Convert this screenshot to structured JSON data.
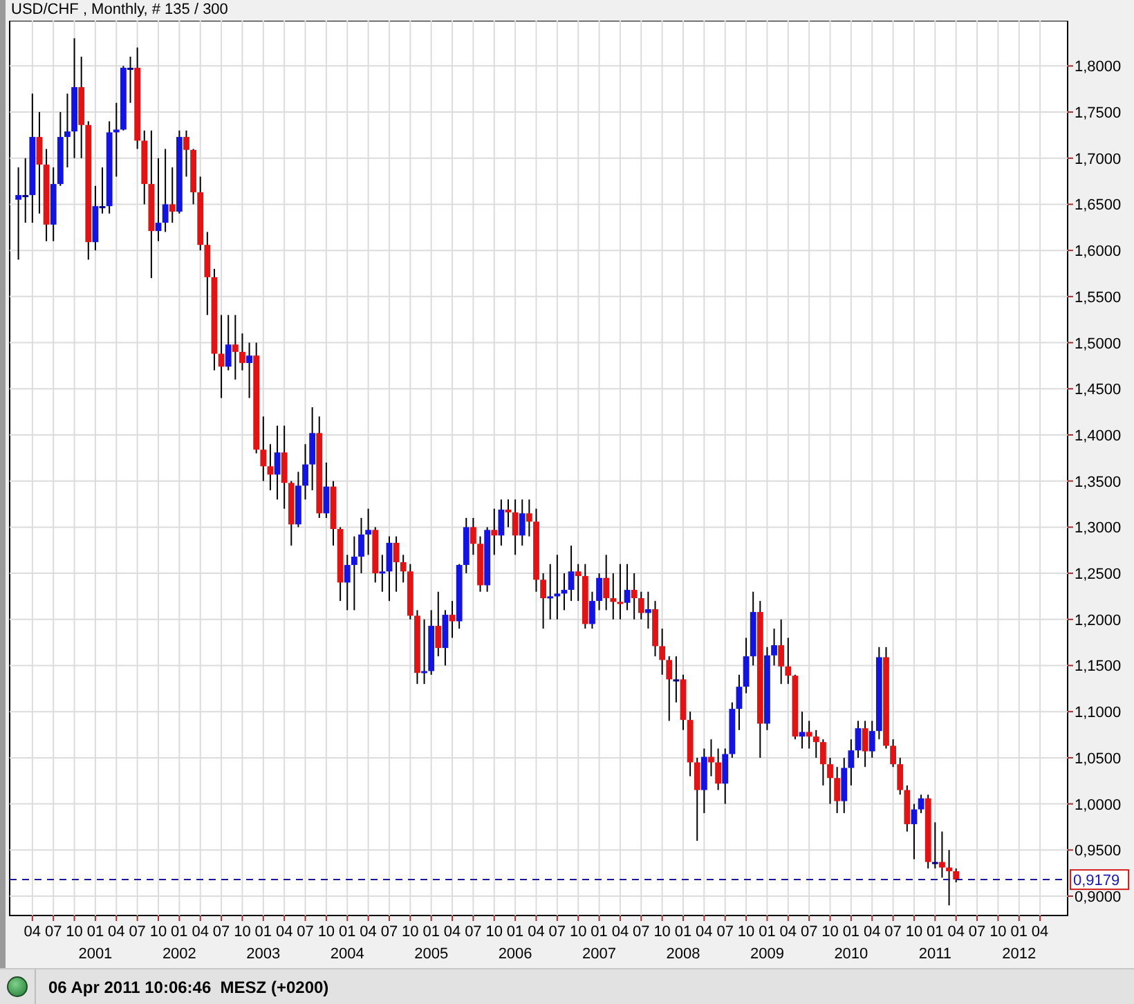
{
  "chart": {
    "chart_data": {
      "type": "candlestick",
      "title": "USD/CHF , Monthly, # 135 / 300",
      "grid": true,
      "ylim": [
        0.879,
        1.849
      ],
      "yticks": [
        {
          "value": 0.9,
          "label": "0,9000"
        },
        {
          "value": 0.95,
          "label": "0,9500"
        },
        {
          "value": 1.0,
          "label": "1,0000"
        },
        {
          "value": 1.05,
          "label": "1,0500"
        },
        {
          "value": 1.1,
          "label": "1,1000"
        },
        {
          "value": 1.15,
          "label": "1,1500"
        },
        {
          "value": 1.2,
          "label": "1,2000"
        },
        {
          "value": 1.25,
          "label": "1,2500"
        },
        {
          "value": 1.3,
          "label": "1,3000"
        },
        {
          "value": 1.35,
          "label": "1,3500"
        },
        {
          "value": 1.4,
          "label": "1,4000"
        },
        {
          "value": 1.45,
          "label": "1,4500"
        },
        {
          "value": 1.5,
          "label": "1,5000"
        },
        {
          "value": 1.55,
          "label": "1,5500"
        },
        {
          "value": 1.6,
          "label": "1,6000"
        },
        {
          "value": 1.65,
          "label": "1,6500"
        },
        {
          "value": 1.7,
          "label": "1,7000"
        },
        {
          "value": 1.75,
          "label": "1,7500"
        },
        {
          "value": 1.8,
          "label": "1,8000"
        }
      ],
      "categories": [
        null,
        null,
        "04",
        null,
        null,
        "07",
        null,
        null,
        "10",
        null,
        null,
        "01",
        null,
        null,
        "04",
        null,
        null,
        "07",
        null,
        null,
        "10",
        null,
        null,
        "01",
        null,
        null,
        "04",
        null,
        null,
        "07",
        null,
        null,
        "10",
        null,
        null,
        "01",
        null,
        null,
        "04",
        null,
        null,
        "07",
        null,
        null,
        "10",
        null,
        null,
        "01",
        null,
        null,
        "04",
        null,
        null,
        "07",
        null,
        null,
        "10",
        null,
        null,
        "01",
        null,
        null,
        "04",
        null,
        null,
        "07",
        null,
        null,
        "10",
        null,
        null,
        "01",
        null,
        null,
        "04",
        null,
        null,
        "07",
        null,
        null,
        "10",
        null,
        null,
        "01",
        null,
        null,
        "04",
        null,
        null,
        "07",
        null,
        null,
        "10",
        null,
        null,
        "01",
        null,
        null,
        "04",
        null,
        null,
        "07",
        null,
        null,
        "10",
        null,
        null,
        "01",
        null,
        null,
        "04",
        null,
        null,
        "07",
        null,
        null,
        "10",
        null,
        null,
        "01",
        null,
        null,
        "04",
        null,
        null,
        "07",
        null,
        null,
        "10",
        null,
        null,
        "01",
        null,
        null,
        "04",
        null,
        null,
        "07",
        null,
        null,
        "10",
        null,
        null,
        "01",
        null,
        null,
        "04"
      ],
      "ohlc": [
        [
          1.655,
          1.69,
          1.59,
          1.66
        ],
        [
          1.66,
          1.7,
          1.63,
          1.66
        ],
        [
          1.66,
          1.77,
          1.63,
          1.723
        ],
        [
          1.723,
          1.75,
          1.64,
          1.693
        ],
        [
          1.693,
          1.71,
          1.61,
          1.628
        ],
        [
          1.628,
          1.69,
          1.61,
          1.672
        ],
        [
          1.672,
          1.75,
          1.67,
          1.723
        ],
        [
          1.723,
          1.77,
          1.69,
          1.729
        ],
        [
          1.729,
          1.83,
          1.7,
          1.777
        ],
        [
          1.777,
          1.81,
          1.7,
          1.736
        ],
        [
          1.736,
          1.74,
          1.59,
          1.609
        ],
        [
          1.609,
          1.67,
          1.6,
          1.648
        ],
        [
          1.648,
          1.69,
          1.64,
          1.648
        ],
        [
          1.648,
          1.74,
          1.64,
          1.728
        ],
        [
          1.728,
          1.76,
          1.68,
          1.731
        ],
        [
          1.731,
          1.8,
          1.73,
          1.798
        ],
        [
          1.798,
          1.81,
          1.76,
          1.798
        ],
        [
          1.798,
          1.82,
          1.71,
          1.719
        ],
        [
          1.719,
          1.73,
          1.65,
          1.672
        ],
        [
          1.672,
          1.73,
          1.57,
          1.621
        ],
        [
          1.621,
          1.7,
          1.61,
          1.63
        ],
        [
          1.63,
          1.71,
          1.62,
          1.65
        ],
        [
          1.65,
          1.69,
          1.63,
          1.642
        ],
        [
          1.642,
          1.73,
          1.64,
          1.723
        ],
        [
          1.723,
          1.73,
          1.68,
          1.709
        ],
        [
          1.709,
          1.71,
          1.65,
          1.663
        ],
        [
          1.663,
          1.68,
          1.6,
          1.606
        ],
        [
          1.606,
          1.62,
          1.53,
          1.571
        ],
        [
          1.571,
          1.58,
          1.47,
          1.488
        ],
        [
          1.488,
          1.53,
          1.44,
          1.474
        ],
        [
          1.474,
          1.53,
          1.47,
          1.498
        ],
        [
          1.498,
          1.53,
          1.46,
          1.49
        ],
        [
          1.49,
          1.51,
          1.47,
          1.478
        ],
        [
          1.478,
          1.5,
          1.44,
          1.486
        ],
        [
          1.486,
          1.5,
          1.38,
          1.384
        ],
        [
          1.384,
          1.42,
          1.35,
          1.366
        ],
        [
          1.366,
          1.39,
          1.34,
          1.357
        ],
        [
          1.357,
          1.41,
          1.33,
          1.381
        ],
        [
          1.381,
          1.41,
          1.32,
          1.348
        ],
        [
          1.348,
          1.35,
          1.28,
          1.303
        ],
        [
          1.303,
          1.36,
          1.3,
          1.345
        ],
        [
          1.345,
          1.39,
          1.33,
          1.368
        ],
        [
          1.368,
          1.43,
          1.34,
          1.402
        ],
        [
          1.402,
          1.42,
          1.31,
          1.315
        ],
        [
          1.315,
          1.37,
          1.31,
          1.344
        ],
        [
          1.344,
          1.35,
          1.28,
          1.298
        ],
        [
          1.298,
          1.3,
          1.22,
          1.24
        ],
        [
          1.24,
          1.27,
          1.21,
          1.259
        ],
        [
          1.259,
          1.29,
          1.21,
          1.268
        ],
        [
          1.268,
          1.31,
          1.25,
          1.292
        ],
        [
          1.292,
          1.32,
          1.27,
          1.297
        ],
        [
          1.297,
          1.3,
          1.24,
          1.25
        ],
        [
          1.25,
          1.27,
          1.23,
          1.252
        ],
        [
          1.252,
          1.29,
          1.22,
          1.283
        ],
        [
          1.283,
          1.29,
          1.23,
          1.262
        ],
        [
          1.262,
          1.27,
          1.24,
          1.252
        ],
        [
          1.252,
          1.26,
          1.2,
          1.204
        ],
        [
          1.204,
          1.21,
          1.13,
          1.142
        ],
        [
          1.142,
          1.2,
          1.13,
          1.144
        ],
        [
          1.144,
          1.21,
          1.14,
          1.193
        ],
        [
          1.193,
          1.23,
          1.16,
          1.169
        ],
        [
          1.169,
          1.21,
          1.15,
          1.205
        ],
        [
          1.205,
          1.22,
          1.18,
          1.198
        ],
        [
          1.198,
          1.26,
          1.19,
          1.259
        ],
        [
          1.259,
          1.31,
          1.25,
          1.3
        ],
        [
          1.3,
          1.31,
          1.27,
          1.282
        ],
        [
          1.282,
          1.29,
          1.23,
          1.237
        ],
        [
          1.237,
          1.3,
          1.23,
          1.297
        ],
        [
          1.297,
          1.32,
          1.27,
          1.291
        ],
        [
          1.291,
          1.33,
          1.28,
          1.319
        ],
        [
          1.319,
          1.33,
          1.3,
          1.316
        ],
        [
          1.316,
          1.33,
          1.27,
          1.291
        ],
        [
          1.291,
          1.33,
          1.28,
          1.315
        ],
        [
          1.315,
          1.33,
          1.29,
          1.306
        ],
        [
          1.306,
          1.32,
          1.23,
          1.243
        ],
        [
          1.243,
          1.25,
          1.19,
          1.223
        ],
        [
          1.223,
          1.26,
          1.2,
          1.225
        ],
        [
          1.225,
          1.27,
          1.2,
          1.228
        ],
        [
          1.228,
          1.25,
          1.21,
          1.232
        ],
        [
          1.232,
          1.28,
          1.22,
          1.252
        ],
        [
          1.252,
          1.26,
          1.22,
          1.247
        ],
        [
          1.247,
          1.26,
          1.19,
          1.195
        ],
        [
          1.195,
          1.23,
          1.19,
          1.22
        ],
        [
          1.22,
          1.25,
          1.21,
          1.245
        ],
        [
          1.245,
          1.27,
          1.21,
          1.223
        ],
        [
          1.223,
          1.25,
          1.2,
          1.219
        ],
        [
          1.219,
          1.26,
          1.2,
          1.218
        ],
        [
          1.218,
          1.26,
          1.21,
          1.232
        ],
        [
          1.232,
          1.25,
          1.2,
          1.223
        ],
        [
          1.223,
          1.23,
          1.2,
          1.207
        ],
        [
          1.207,
          1.23,
          1.19,
          1.211
        ],
        [
          1.211,
          1.22,
          1.16,
          1.171
        ],
        [
          1.171,
          1.19,
          1.14,
          1.156
        ],
        [
          1.156,
          1.16,
          1.09,
          1.135
        ],
        [
          1.135,
          1.16,
          1.11,
          1.135
        ],
        [
          1.135,
          1.14,
          1.08,
          1.091
        ],
        [
          1.091,
          1.1,
          1.03,
          1.045
        ],
        [
          1.045,
          1.05,
          0.96,
          1.015
        ],
        [
          1.015,
          1.06,
          0.99,
          1.051
        ],
        [
          1.051,
          1.07,
          1.03,
          1.045
        ],
        [
          1.045,
          1.06,
          1.015,
          1.022
        ],
        [
          1.022,
          1.06,
          1.0,
          1.054
        ],
        [
          1.054,
          1.11,
          1.05,
          1.103
        ],
        [
          1.103,
          1.14,
          1.08,
          1.127
        ],
        [
          1.127,
          1.18,
          1.12,
          1.16
        ],
        [
          1.16,
          1.23,
          1.15,
          1.208
        ],
        [
          1.208,
          1.22,
          1.05,
          1.087
        ],
        [
          1.087,
          1.17,
          1.08,
          1.161
        ],
        [
          1.161,
          1.19,
          1.15,
          1.172
        ],
        [
          1.172,
          1.2,
          1.13,
          1.149
        ],
        [
          1.149,
          1.18,
          1.13,
          1.139
        ],
        [
          1.139,
          1.14,
          1.07,
          1.073
        ],
        [
          1.073,
          1.1,
          1.06,
          1.078
        ],
        [
          1.078,
          1.09,
          1.06,
          1.073
        ],
        [
          1.073,
          1.08,
          1.05,
          1.067
        ],
        [
          1.067,
          1.07,
          1.02,
          1.043
        ],
        [
          1.043,
          1.05,
          1.0,
          1.028
        ],
        [
          1.028,
          1.04,
          0.99,
          1.003
        ],
        [
          1.003,
          1.05,
          0.99,
          1.039
        ],
        [
          1.039,
          1.07,
          1.02,
          1.058
        ],
        [
          1.058,
          1.09,
          1.05,
          1.082
        ],
        [
          1.082,
          1.09,
          1.04,
          1.057
        ],
        [
          1.057,
          1.09,
          1.05,
          1.079
        ],
        [
          1.079,
          1.17,
          1.07,
          1.159
        ],
        [
          1.159,
          1.17,
          1.06,
          1.063
        ],
        [
          1.063,
          1.07,
          1.04,
          1.043
        ],
        [
          1.043,
          1.05,
          1.01,
          1.015
        ],
        [
          1.015,
          1.02,
          0.97,
          0.978
        ],
        [
          0.978,
          1.0,
          0.94,
          0.994
        ],
        [
          0.994,
          1.01,
          0.99,
          1.006
        ],
        [
          1.006,
          1.01,
          0.93,
          0.937
        ],
        [
          0.937,
          0.98,
          0.93,
          0.937
        ],
        [
          0.937,
          0.97,
          0.92,
          0.931
        ],
        [
          0.931,
          0.95,
          0.89,
          0.927
        ],
        [
          0.927,
          0.93,
          0.915,
          0.918
        ],
        null,
        null,
        null,
        null,
        null,
        null,
        null,
        null,
        null,
        null,
        null,
        null
      ],
      "ref_lines": [
        {
          "axis": "y",
          "value": 0.9179,
          "label": "0,9179"
        }
      ]
    },
    "year_labels": [
      "2001",
      "2002",
      "2003",
      "2004",
      "2005",
      "2006",
      "2007",
      "2008",
      "2009",
      "2010",
      "2011",
      "2012"
    ]
  },
  "status_bar": {
    "connected": true,
    "timestamp": "06 Apr 2011 10:06:46  MESZ (+0200)"
  }
}
